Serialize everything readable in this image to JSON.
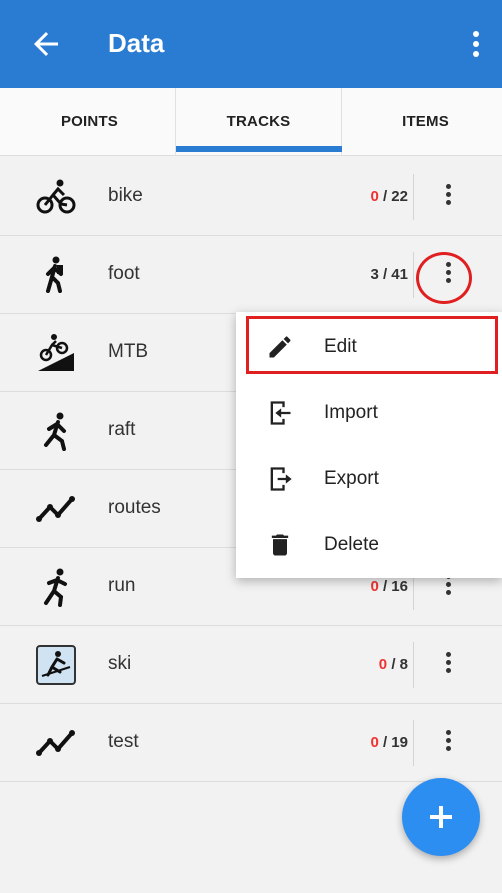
{
  "appbar": {
    "title": "Data",
    "back_icon": "arrow-left-icon",
    "menu_icon": "more-vert-icon"
  },
  "tabs": [
    {
      "label": "POINTS",
      "active": false
    },
    {
      "label": "TRACKS",
      "active": true
    },
    {
      "label": "ITEMS",
      "active": false
    }
  ],
  "tracks": [
    {
      "name": "bike",
      "visible": "0",
      "total": "/ 22",
      "icon": "bicycle-icon"
    },
    {
      "name": "foot",
      "visible": "3",
      "total": "/ 41",
      "icon": "hiker-icon"
    },
    {
      "name": "MTB",
      "visible": "",
      "total": "",
      "icon": "mountain-bike-icon"
    },
    {
      "name": "raft",
      "visible": "",
      "total": "",
      "icon": "walker-icon"
    },
    {
      "name": "routes",
      "visible": "",
      "total": "",
      "icon": "route-line-icon"
    },
    {
      "name": "run",
      "visible": "0",
      "total": "/ 16",
      "icon": "runner-icon"
    },
    {
      "name": "ski",
      "visible": "0",
      "total": "/ 8",
      "icon": "skier-icon"
    },
    {
      "name": "test",
      "visible": "0",
      "total": "/ 19",
      "icon": "route-line-icon"
    }
  ],
  "context_menu": {
    "edit": "Edit",
    "import": "Import",
    "export": "Export",
    "delete": "Delete"
  },
  "colors": {
    "primary": "#2a7bd2",
    "fab": "#2c8ef0",
    "highlight": "#e02020",
    "zero_count": "#e33333"
  }
}
